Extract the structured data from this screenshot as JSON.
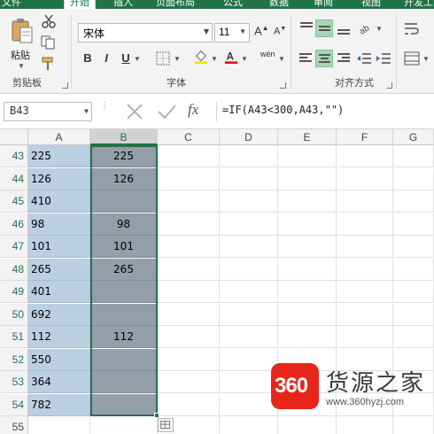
{
  "ribbon_tabs": [
    "文件",
    "开始",
    "插入",
    "页面布局",
    "公式",
    "数据",
    "审阅",
    "视图",
    "开发工"
  ],
  "ribbon_active_tab": "开始",
  "clipboard": {
    "paste_label": "粘贴",
    "group_label": "剪贴板"
  },
  "font": {
    "name": "宋体",
    "size": "11",
    "bold": "B",
    "italic": "I",
    "underline": "U",
    "grow": "A",
    "shrink": "A",
    "phonetic": "wén",
    "group_label": "字体"
  },
  "alignment": {
    "group_label": "对齐方式"
  },
  "formula_bar": {
    "name_box": "B43",
    "formula": "=IF(A43<300,A43,\"\")",
    "fx_label": "fx"
  },
  "sheet": {
    "columns": [
      "A",
      "B",
      "C",
      "D",
      "E",
      "F",
      "G"
    ],
    "rows": [
      {
        "num": "43",
        "a": "225",
        "b": "225"
      },
      {
        "num": "44",
        "a": "126",
        "b": "126"
      },
      {
        "num": "45",
        "a": "410",
        "b": ""
      },
      {
        "num": "46",
        "a": "98",
        "b": "98"
      },
      {
        "num": "47",
        "a": "101",
        "b": "101"
      },
      {
        "num": "48",
        "a": "265",
        "b": "265"
      },
      {
        "num": "49",
        "a": "401",
        "b": ""
      },
      {
        "num": "50",
        "a": "692",
        "b": ""
      },
      {
        "num": "51",
        "a": "112",
        "b": "112"
      },
      {
        "num": "52",
        "a": "550",
        "b": ""
      },
      {
        "num": "53",
        "a": "364",
        "b": ""
      },
      {
        "num": "54",
        "a": "782",
        "b": ""
      },
      {
        "num": "55",
        "a": "",
        "b": ""
      }
    ]
  },
  "watermark": {
    "badge": "360",
    "title": "货源之家",
    "url": "www.360hyzj.com"
  },
  "colors": {
    "accent": "#217346",
    "col_a_fill": "#bbcfe3",
    "col_b_fill": "#939ea9",
    "badge_red": "#e8251c"
  }
}
